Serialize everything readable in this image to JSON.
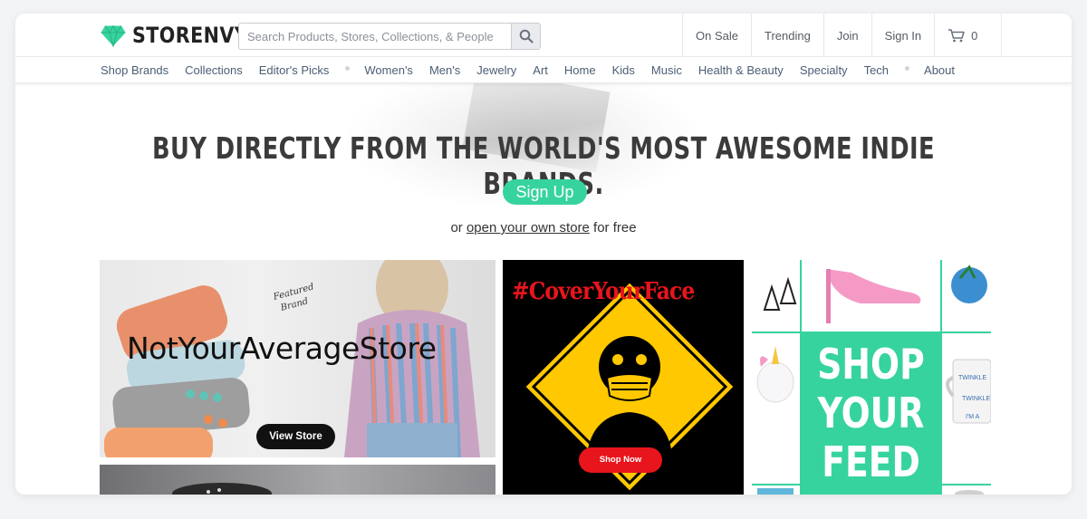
{
  "brand": {
    "name": "STORENVY",
    "accent": "#36d39f"
  },
  "search": {
    "placeholder": "Search Products, Stores, Collections, & People",
    "icon": "search-icon"
  },
  "toplinks": {
    "on_sale": "On Sale",
    "trending": "Trending",
    "join": "Join",
    "sign_in": "Sign In",
    "cart_count": "0"
  },
  "categories": [
    "Shop Brands",
    "Collections",
    "Editor's Picks",
    "Women's",
    "Men's",
    "Jewelry",
    "Art",
    "Home",
    "Kids",
    "Music",
    "Health & Beauty",
    "Specialty",
    "Tech",
    "About"
  ],
  "hero": {
    "headline": "BUY DIRECTLY FROM THE WORLD'S MOST AWESOME INDIE BRANDS.",
    "signup_label": "Sign Up",
    "sub_prefix": "or ",
    "sub_link": "open your own store",
    "sub_suffix": " for free"
  },
  "tiles": {
    "store1": {
      "title": "NotYourAverageStore",
      "button": "View Store"
    },
    "store2": {
      "tag": "#CoverYourFace",
      "button": "Shop Now",
      "accent": "#e8151c",
      "sign_color": "#ffc800"
    },
    "store3": {
      "line1": "SHOP",
      "line2": "YOUR",
      "line3": "FEED",
      "mug_text_1": "TWINKLE",
      "mug_text_2": "TWINKLE",
      "mug_text_3": "I'M A"
    }
  }
}
